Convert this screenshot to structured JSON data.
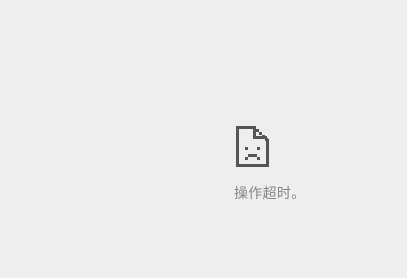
{
  "page": {
    "background_color": "#eeeeee"
  },
  "error": {
    "icon": "sad-page-icon",
    "icon_color": "#555555",
    "message": "操作超时。",
    "message_color": "#858585"
  }
}
